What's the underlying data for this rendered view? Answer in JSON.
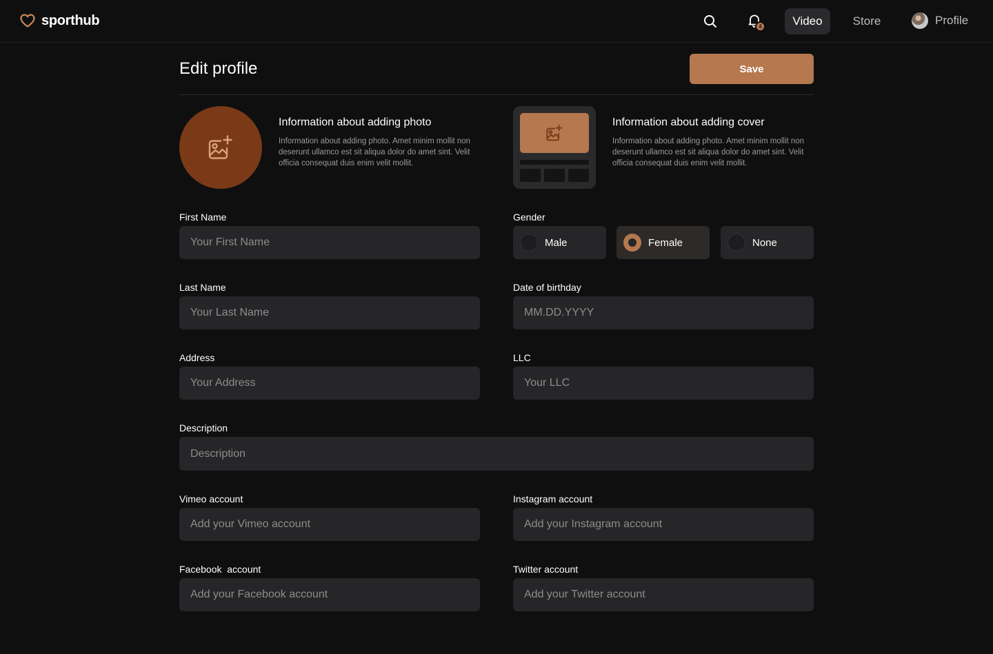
{
  "header": {
    "logo_text": "sporthub",
    "bell_count": "4",
    "nav": {
      "video": "Video",
      "store": "Store",
      "profile": "Profile"
    }
  },
  "page": {
    "title": "Edit profile",
    "save_label": "Save"
  },
  "photo": {
    "title": "Information about adding photo",
    "text": "Information about adding photo. Amet minim mollit non deserunt ullamco est sit aliqua dolor do amet sint. Velit officia consequat duis enim velit mollit."
  },
  "cover": {
    "title": "Information about adding cover",
    "text": "Information about adding photo. Amet minim mollit non deserunt ullamco est sit aliqua dolor do amet sint. Velit officia consequat duis enim velit mollit."
  },
  "form": {
    "first_name": {
      "label": "First Name",
      "placeholder": "Your First Name"
    },
    "last_name": {
      "label": "Last Name",
      "placeholder": "Your Last Name"
    },
    "address": {
      "label": "Address",
      "placeholder": "Your Address"
    },
    "gender": {
      "label": "Gender",
      "options": [
        "Male",
        "Female",
        "None"
      ],
      "selected": "Female"
    },
    "birthday": {
      "label": "Date of birthday",
      "placeholder": "MM.DD.YYYY"
    },
    "llc": {
      "label": "LLC",
      "placeholder": "Your LLC"
    },
    "description": {
      "label": "Description",
      "placeholder": "Description"
    },
    "vimeo": {
      "label": "Vimeo account",
      "placeholder": "Add your Vimeo account"
    },
    "instagram": {
      "label": "Instagram account",
      "placeholder": "Add your Instagram account"
    },
    "facebook": {
      "label": "Facebook  account",
      "placeholder": "Add your Facebook account"
    },
    "twitter": {
      "label": "Twitter account",
      "placeholder": "Add your Twitter account"
    }
  },
  "colors": {
    "background": "#0f0f10",
    "accent": "#b5784f",
    "photo_circle": "#7a3a17",
    "input_bg": "#262628"
  }
}
